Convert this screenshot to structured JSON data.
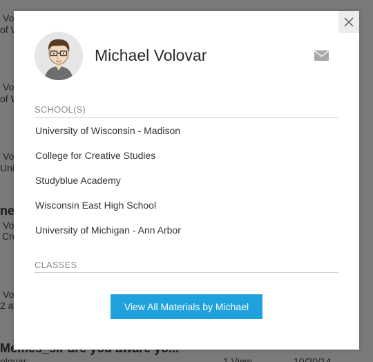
{
  "background": {
    "snippets": [
      {
        "id": "bg-text-1a",
        "text": "Vo"
      },
      {
        "id": "bg-text-1b",
        "text": "of W"
      },
      {
        "id": "bg-text-2a",
        "text": "Vo"
      },
      {
        "id": "bg-text-2b",
        "text": "of W"
      },
      {
        "id": "bg-text-3a",
        "text": "Vo"
      },
      {
        "id": "bg-text-3b",
        "text": "Univ"
      },
      {
        "id": "bg-text-4a",
        "text": "nera"
      },
      {
        "id": "bg-text-4b",
        "text": "Vo"
      },
      {
        "id": "bg-text-4c",
        "text": "Cre"
      },
      {
        "id": "bg-text-5a",
        "text": "Vo"
      },
      {
        "id": "bg-text-5b",
        "text": "2 at"
      },
      {
        "id": "bg-text-6a",
        "text": "Memes_sir are you aware yo..."
      },
      {
        "id": "bg-text-6b",
        "text": "olovar"
      },
      {
        "id": "bg-text-6c",
        "text": "1 View"
      },
      {
        "id": "bg-text-6d",
        "text": "10/20/14"
      }
    ]
  },
  "modal": {
    "close_label": "Close",
    "profile": {
      "name": "Michael Volovar",
      "avatar_icon": "cartoon-avatar"
    },
    "mail_icon": "mail-icon",
    "schools_label": "SCHOOL(S)",
    "schools": [
      "University of Wisconsin - Madison",
      "College for Creative Studies",
      "Studyblue Academy",
      "Wisconsin East High School",
      "University of Michigan - Ann Arbor"
    ],
    "classes_label": "CLASSES",
    "view_all_label": "View All Materials by Michael"
  },
  "colors": {
    "accent": "#1fa2dc",
    "backdrop": "#7a7a7a",
    "modal_bg": "#ffffff"
  }
}
